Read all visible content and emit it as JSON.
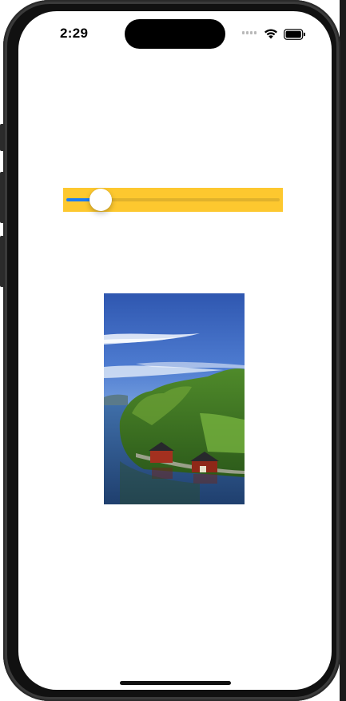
{
  "status_bar": {
    "time": "2:29",
    "icons": [
      "cellular-signal-icon",
      "wifi-icon",
      "battery-icon"
    ]
  },
  "slider": {
    "value": 0.16,
    "track_color": "#e0b22c",
    "fill_color": "#1c7cf2",
    "background_color": "#fdc82f"
  },
  "photo": {
    "subject": "landscape-photo"
  },
  "colors": {
    "accent": "#1c7cf2",
    "slider_background": "#fdc82f"
  }
}
